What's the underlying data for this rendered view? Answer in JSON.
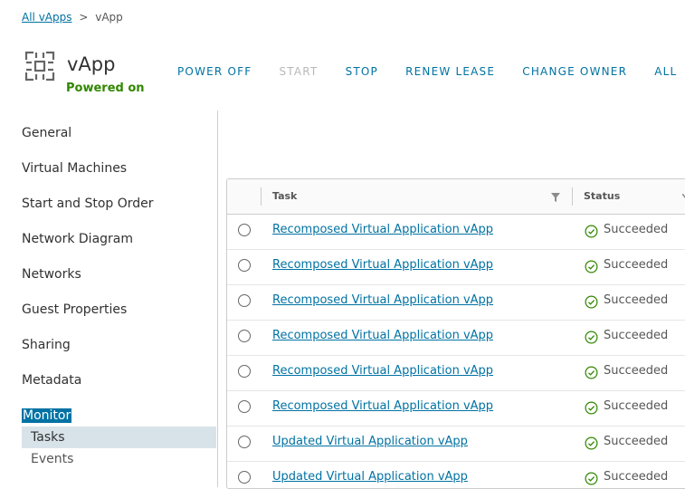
{
  "breadcrumb": {
    "root": "All vApps",
    "separator": ">",
    "current": "vApp"
  },
  "header": {
    "title": "vApp",
    "status": "Powered on",
    "status_color": "#318700",
    "icon": "vapp-icon"
  },
  "actions": [
    {
      "label": "POWER OFF",
      "enabled": true
    },
    {
      "label": "START",
      "enabled": false
    },
    {
      "label": "STOP",
      "enabled": true
    },
    {
      "label": "RENEW LEASE",
      "enabled": true
    },
    {
      "label": "CHANGE OWNER",
      "enabled": true
    },
    {
      "label": "ALL",
      "enabled": true
    }
  ],
  "sidebar": {
    "items": [
      "General",
      "Virtual Machines",
      "Start and Stop Order",
      "Network Diagram",
      "Networks",
      "Guest Properties",
      "Sharing",
      "Metadata",
      "Monitor"
    ],
    "active": "Monitor",
    "sub_items": [
      "Tasks",
      "Events"
    ],
    "selected_sub": "Tasks"
  },
  "grid": {
    "columns": {
      "task": "Task",
      "status": "Status"
    },
    "rows": [
      {
        "task": "Recomposed Virtual Application vApp",
        "status": "Succeeded"
      },
      {
        "task": "Recomposed Virtual Application vApp",
        "status": "Succeeded"
      },
      {
        "task": "Recomposed Virtual Application vApp",
        "status": "Succeeded"
      },
      {
        "task": "Recomposed Virtual Application vApp",
        "status": "Succeeded"
      },
      {
        "task": "Recomposed Virtual Application vApp",
        "status": "Succeeded"
      },
      {
        "task": "Recomposed Virtual Application vApp",
        "status": "Succeeded"
      },
      {
        "task": "Updated Virtual Application vApp",
        "status": "Succeeded"
      },
      {
        "task": "Updated Virtual Application vApp",
        "status": "Succeeded"
      }
    ]
  },
  "colors": {
    "accent": "#0072a3",
    "success": "#318700"
  }
}
